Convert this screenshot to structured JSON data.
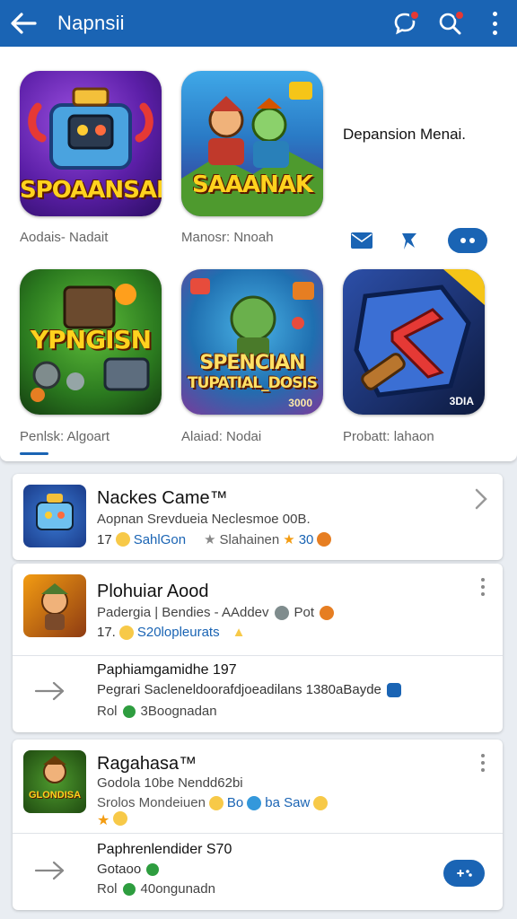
{
  "appbar": {
    "title": "Napnsii",
    "icons": [
      "back-arrow-icon",
      "chat-bubble-icon",
      "search-icon",
      "more-vert-icon"
    ],
    "color": "#1a64b4"
  },
  "featured": {
    "side_title": "Depansion Menai.",
    "tiles": [
      {
        "word": "SPOAANSAI",
        "caption": "Aodais- Nadait"
      },
      {
        "word": "SAAANAK",
        "caption": "Manosr: Nnoah"
      },
      {
        "word": "YPNGISN",
        "caption": "Penlsk: Algoart"
      },
      {
        "word": "SPENCIAN",
        "word2": "TUPATIAL_DOSIS",
        "badge": "3000",
        "caption": "Alaiad: Nodai"
      },
      {
        "word": "",
        "badge": "3DIA",
        "caption": "Probatt: lahaon"
      }
    ]
  },
  "list": [
    {
      "title": "Nackes Came™",
      "desc": "Aopnan Srevdueia Neclesmoe 00B.",
      "meta_num": "17",
      "meta_link": "SahlGon",
      "meta_gray": "Slahainen",
      "meta_score": "30"
    },
    {
      "title": "Plohuiar Aood",
      "desc": "Padergia | Bendies - AAddev",
      "desc_tail": "Pot",
      "meta_num": "17.",
      "meta_link": "S20lopleurats",
      "sub_title": "Paphiamgamidhe 197",
      "sub_desc": "Pegrari Sacleneldoorafdjoeadilans 1380aBayde",
      "sub_meta": "Rol",
      "sub_meta2": "3Boognadan"
    },
    {
      "title": "Ragahasa™",
      "desc": "Godola 10be Nendd62bi",
      "meta_line": "Srolos Mondeiuen",
      "meta_link": "Bo",
      "meta_tail": "ba Saw",
      "thumb_word": "GLONDISA",
      "sub_title": "Paphrenlendider S70",
      "sub_desc": "Gotaoo",
      "sub_meta": "Rol",
      "sub_meta2": "40ongunadn"
    }
  ]
}
